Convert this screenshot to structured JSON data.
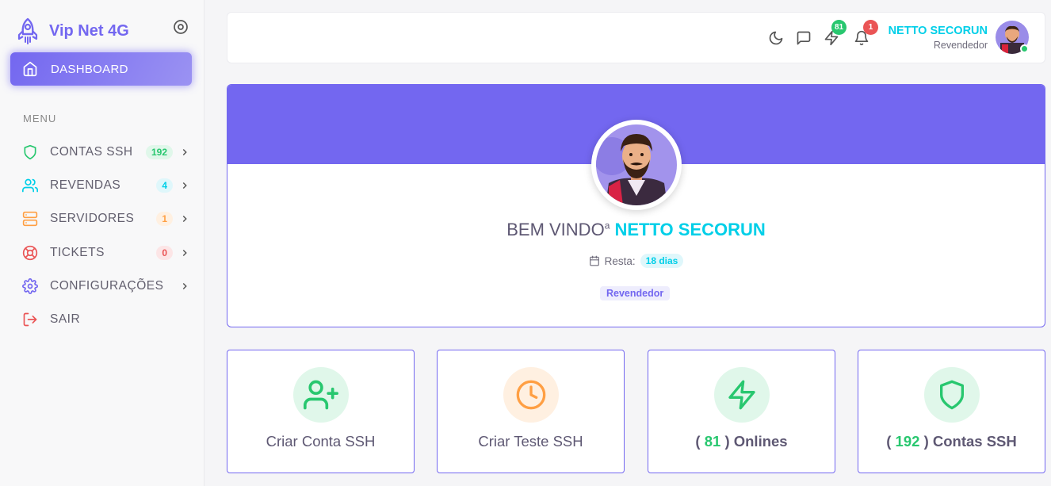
{
  "brand": {
    "name": "Vip Net 4G"
  },
  "sidebar": {
    "active_item": {
      "label": "DASHBOARD"
    },
    "menu_header": "MENU",
    "items": [
      {
        "label": "CONTAS SSH",
        "badge": "192",
        "icon": "shield-icon"
      },
      {
        "label": "REVENDAS",
        "badge": "4",
        "icon": "users-icon"
      },
      {
        "label": "SERVIDORES",
        "badge": "1",
        "icon": "server-icon"
      },
      {
        "label": "TICKETS",
        "badge": "0",
        "icon": "life-buoy-icon"
      },
      {
        "label": "CONFIGURAÇÕES",
        "icon": "settings-icon"
      },
      {
        "label": "SAIR",
        "icon": "log-out-icon"
      }
    ]
  },
  "topbar": {
    "onlines_badge": "81",
    "notifications_badge": "1",
    "user_name": "NETTO SECORUN",
    "user_role": "Revendedor"
  },
  "profile": {
    "welcome": "BEM VINDO",
    "welcome_sup": "a",
    "name": "NETTO SECORUN",
    "resta_label": "Resta:",
    "resta_value": "18 dias",
    "role": "Revendedor"
  },
  "actions": [
    {
      "label": "Criar Conta SSH",
      "icon": "user-plus-icon"
    },
    {
      "label": "Criar Teste SSH",
      "icon": "clock-icon"
    },
    {
      "prefix": "(",
      "count": "81",
      "suffix": ") Onlines",
      "icon": "zap-icon"
    },
    {
      "prefix": "(",
      "count": "192",
      "suffix": ") Contas SSH",
      "icon": "shield-icon"
    }
  ],
  "colors": {
    "primary": "#7367f0",
    "success": "#28c76f",
    "info": "#00cfe8",
    "warning": "#ff9f43",
    "danger": "#ea5455"
  }
}
